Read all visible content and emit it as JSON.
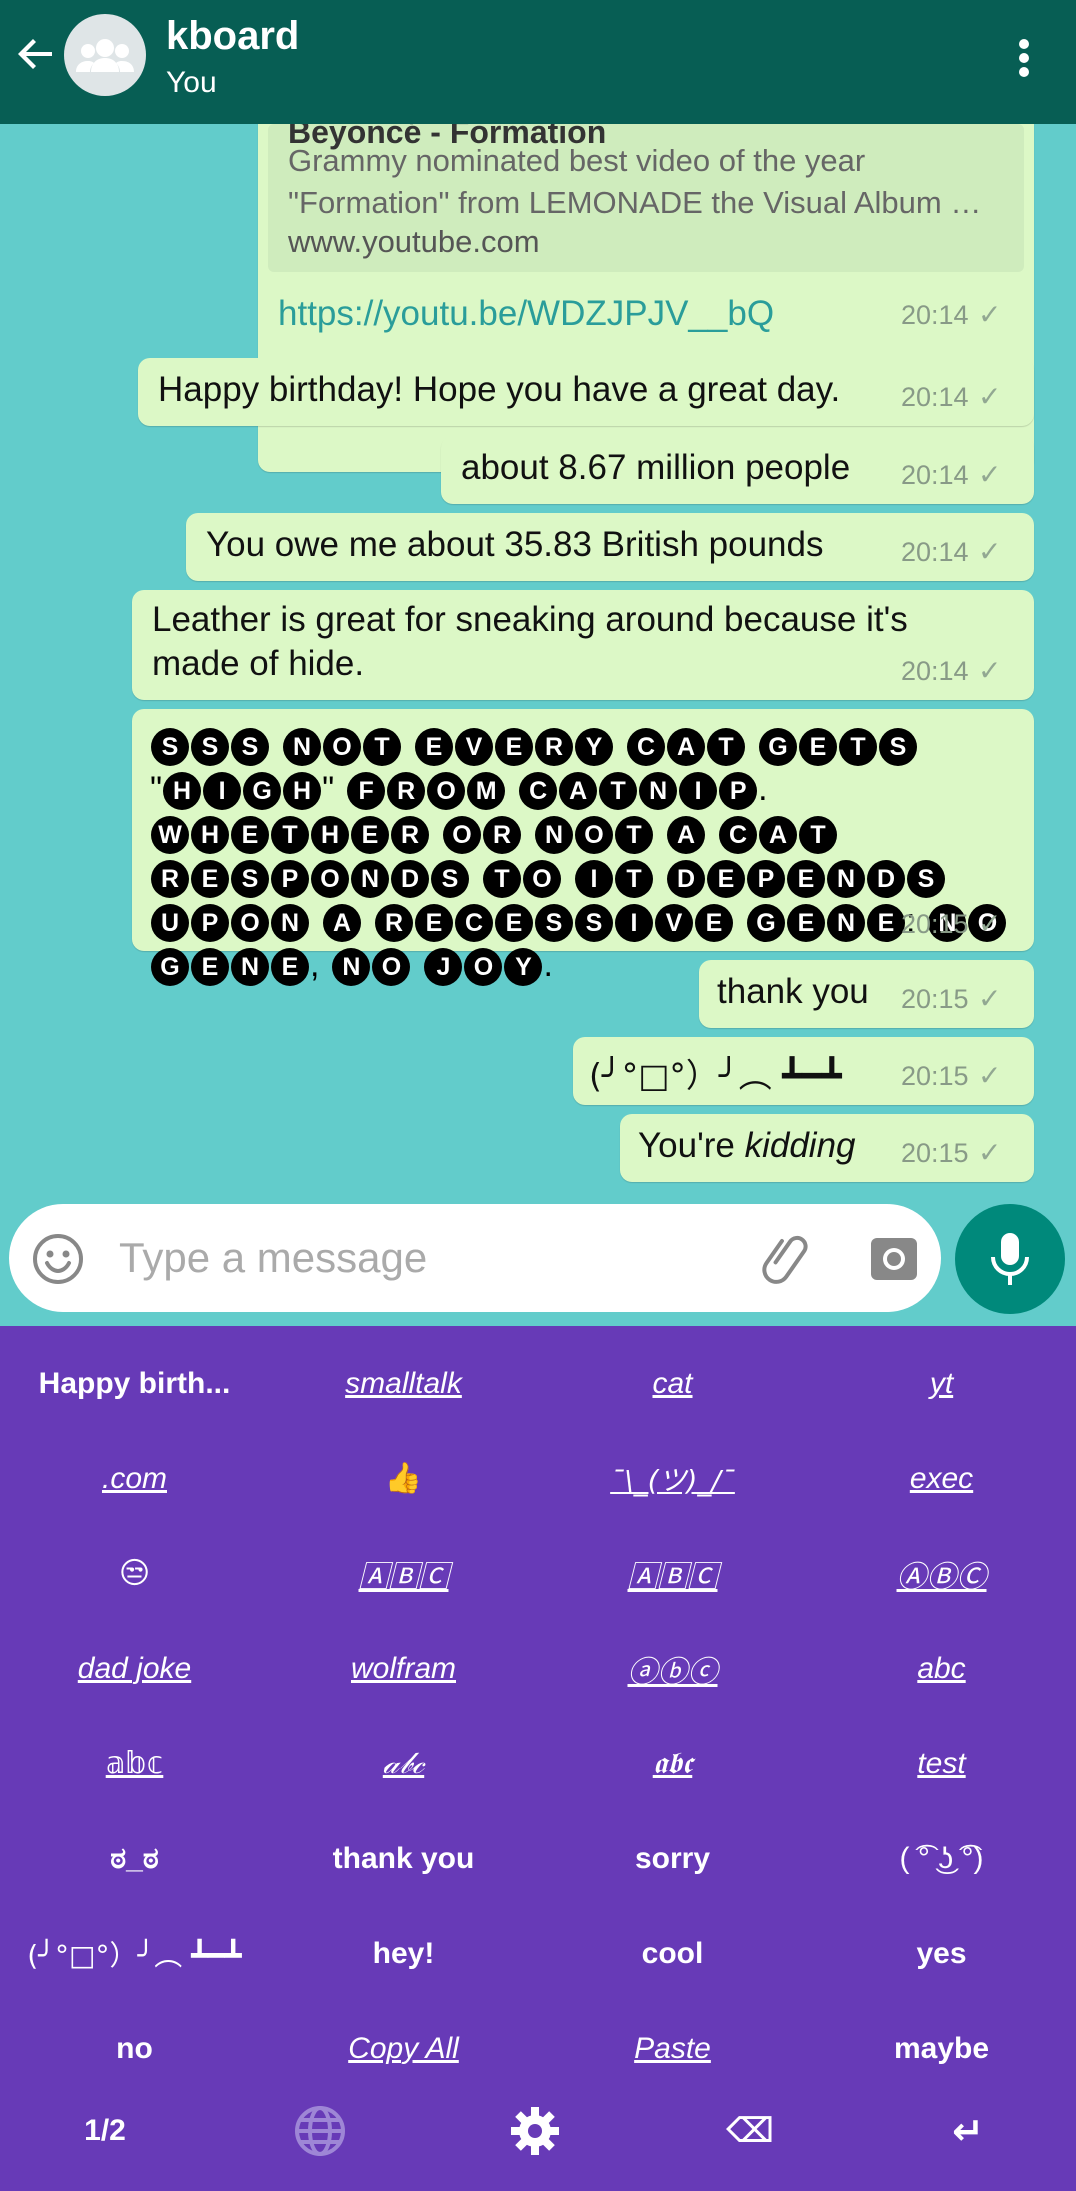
{
  "header": {
    "title": "kboard",
    "subtitle": "You",
    "colors": {
      "bar": "#075e54",
      "chat_bg": "#62cccb",
      "bubble": "#dcf8c6",
      "keyboard": "#673ab7",
      "mic": "#00897b"
    }
  },
  "messages": {
    "link": {
      "preview_title": "Beyoncé - Formation",
      "preview_desc": "Grammy nominated best video of the year \"Formation\" from LEMONADE the Visual Album …",
      "preview_domain": "www.youtube.com",
      "url": "https://youtu.be/WDZJPJV__bQ",
      "time": "20:14"
    },
    "m1": {
      "text": "Happy birthday! Hope you have a great day.",
      "time": "20:14"
    },
    "m2": {
      "text": "about 8.67 million people",
      "time": "20:14"
    },
    "m3": {
      "text": "You owe me  about 35.83 British pounds",
      "time": "20:14"
    },
    "m4": {
      "line1": "Leather is great for sneaking around because it's",
      "line2": "made of hide.",
      "time": "20:14"
    },
    "m5": {
      "text": "SSS NOT EVERY CAT GETS \"HIGH\" FROM CATNIP. WHETHER OR NOT A CAT RESPONDS TO IT DEPENDS UPON A RECESSIVE GENE: NO GENE, NO JOY.",
      "time": "20:15"
    },
    "m6": {
      "text": "thank you",
      "time": "20:15"
    },
    "m7": {
      "text": "(╯°□°）╯︵ ┻━┻",
      "time": "20:15"
    },
    "m8": {
      "text_plain": "You're ",
      "text_italic": "kidding",
      "time": "20:15"
    }
  },
  "input": {
    "placeholder": "Type a message"
  },
  "keyboard": {
    "rows": [
      [
        "Happy birth...",
        "smalltalk",
        "cat",
        "yt"
      ],
      [
        ".com",
        "👍",
        "¯\\_(ツ)_/¯",
        "exec"
      ],
      [
        "😒",
        "🄰🄱🄲",
        "🄰🄱🄲",
        "ⒶⒷⒸ"
      ],
      [
        "dad joke",
        "wolfram",
        "ⓐⓑⓒ",
        "abc"
      ],
      [
        "𝕒𝕓𝕔",
        "𝒶𝒷𝒸",
        "𝖆𝖇𝖈",
        "test"
      ],
      [
        "ಠ_ಠ",
        "thank you",
        "sorry",
        "( ͡° ͜ʖ ͡°)"
      ],
      [
        "(╯°□°）╯︵ ┻━┻",
        "hey!",
        "cool",
        "yes"
      ],
      [
        "no",
        "Copy All",
        "Paste",
        "maybe"
      ]
    ],
    "bottom": {
      "page": "1/2",
      "globe_icon": "globe-icon",
      "settings_icon": "gear-icon",
      "backspace": "⌫",
      "enter": "↵"
    }
  }
}
